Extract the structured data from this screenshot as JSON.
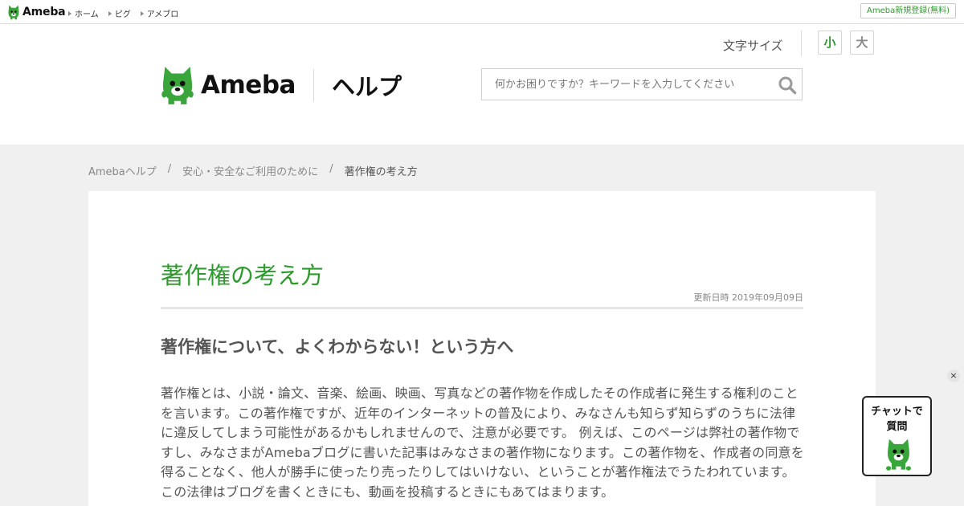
{
  "topbar": {
    "brand": "Ameba",
    "nav": [
      {
        "label": "ホーム"
      },
      {
        "label": "ピグ"
      },
      {
        "label": "アメブロ"
      }
    ],
    "signup_label": "Ameba新規登録(無料)"
  },
  "header": {
    "logo_text": "Ameba",
    "help_text": "ヘルプ",
    "font_size_label": "文字サイズ",
    "font_small_label": "小",
    "font_large_label": "大",
    "search_placeholder": "何かお困りですか？キーワードを入力してください",
    "search_value": ""
  },
  "breadcrumb": {
    "items": [
      {
        "label": "Amebaヘルプ"
      },
      {
        "label": "安心・安全なご利用のために"
      },
      {
        "label": "著作権の考え方"
      }
    ],
    "separator": "/"
  },
  "article": {
    "title": "著作権の考え方",
    "updated": "更新日時 2019年09月09日",
    "section_heading": "著作権について、よくわからない！という方へ",
    "body": "著作権とは、小説・論文、音楽、絵画、映画、写真などの著作物を作成したその作成者に発生する権利のことを言います。この著作権ですが、近年のインターネットの普及により、みなさんも知らず知らずのうちに法律に違反してしまう可能性があるかもしれませんので、注意が必要です。 例えば、このページは弊社の著作物ですし、みなさまがAmebaブログに書いた記事はみなさまの著作物になります。この著作物を、作成者の同意を得ることなく、他人が勝手に使ったり売ったりしてはいけない、ということが著作権法でうたわれています。この法律はブログを書くときにも、動画を投稿するときにもあてはまります。"
  },
  "chat": {
    "line1": "チャットで",
    "line2": "質問",
    "close_label": "×"
  },
  "colors": {
    "brand_green": "#2d9a2d",
    "mascot_green": "#3aa53a",
    "background_gray": "#f0f0f0"
  },
  "icons": [
    "ameba-mascot-icon",
    "search-icon",
    "close-icon",
    "triangle-bullet-icon"
  ]
}
